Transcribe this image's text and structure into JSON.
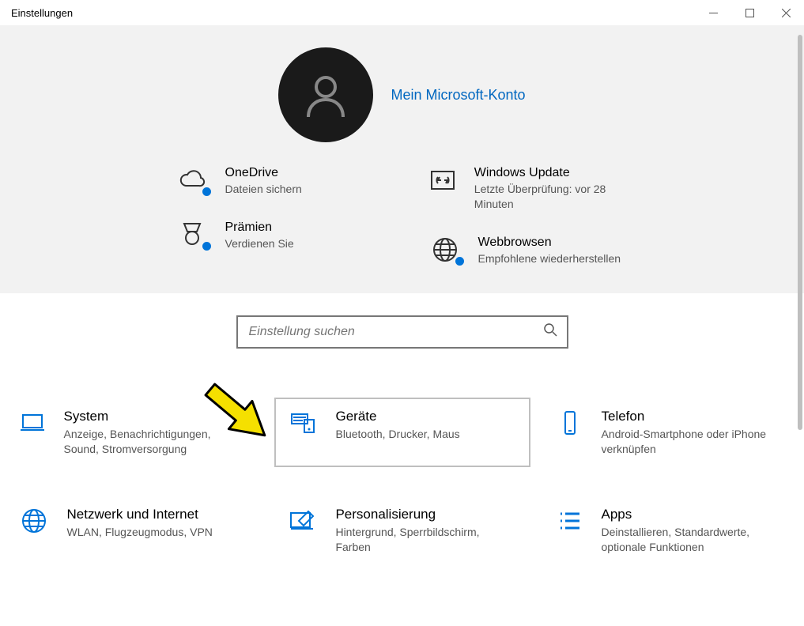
{
  "window": {
    "title": "Einstellungen"
  },
  "account": {
    "link": "Mein Microsoft-Konto"
  },
  "tiles": {
    "onedrive": {
      "title": "OneDrive",
      "sub": "Dateien sichern"
    },
    "reward": {
      "title": "Prämien",
      "sub": "Verdienen Sie"
    },
    "update": {
      "title": "Windows Update",
      "sub": "Letzte Überprüfung: vor 28 Minuten"
    },
    "browser": {
      "title": "Webbrowsen",
      "sub": "Empfohlene wiederherstellen"
    }
  },
  "search": {
    "placeholder": "Einstellung suchen"
  },
  "categories": {
    "system": {
      "title": "System",
      "sub": "Anzeige, Benachrichtigungen, Sound, Stromversorgung"
    },
    "devices": {
      "title": "Geräte",
      "sub": "Bluetooth, Drucker, Maus"
    },
    "phone": {
      "title": "Telefon",
      "sub": "Android-Smartphone oder iPhone verknüpfen"
    },
    "network": {
      "title": "Netzwerk und Internet",
      "sub": "WLAN, Flugzeugmodus, VPN"
    },
    "personal": {
      "title": "Personalisierung",
      "sub": "Hintergrund, Sperrbildschirm, Farben"
    },
    "apps": {
      "title": "Apps",
      "sub": "Deinstallieren, Standardwerte, optionale Funktionen"
    }
  }
}
